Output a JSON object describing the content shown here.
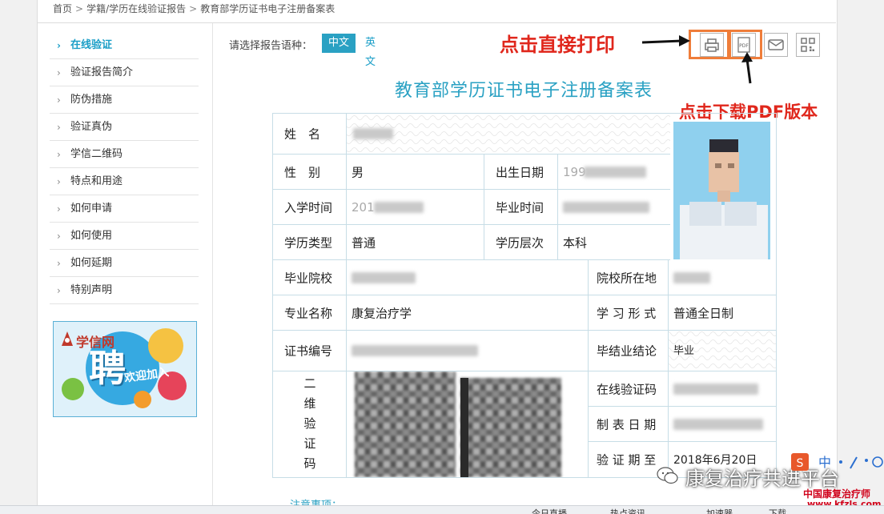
{
  "breadcrumb": [
    "首页",
    "学籍/学历在线验证报告",
    "教育部学历证书电子注册备案表"
  ],
  "sidebar": {
    "items": [
      {
        "label": "在线验证",
        "active": true
      },
      {
        "label": "验证报告简介"
      },
      {
        "label": "防伪措施"
      },
      {
        "label": "验证真伪"
      },
      {
        "label": "学信二维码"
      },
      {
        "label": "特点和用途"
      },
      {
        "label": "如何申请"
      },
      {
        "label": "如何使用"
      },
      {
        "label": "如何延期"
      },
      {
        "label": "特别声明"
      }
    ],
    "ad": {
      "brand": "学信网",
      "big": "聘",
      "small": "欢迎加入"
    }
  },
  "language": {
    "prompt": "请选择报告语种：",
    "options": [
      "中文",
      "英文"
    ],
    "selected": "中文"
  },
  "toolbar": {
    "icons": [
      "print-icon",
      "pdf-icon",
      "mail-icon",
      "qr-icon"
    ]
  },
  "annotations": {
    "print": "点击直接打印",
    "pdf": "点击下载PDF版本"
  },
  "report": {
    "title": "教育部学历证书电子注册备案表",
    "labels": {
      "name": "姓　名",
      "gender": "性　别",
      "birth": "出生日期",
      "enroll": "入学时间",
      "graduate": "毕业时间",
      "edu_type": "学历类型",
      "edu_level": "学历层次",
      "school": "毕业院校",
      "school_loc": "院校所在地",
      "major": "专业名称",
      "study_form": "学 习 形 式",
      "cert_no": "证书编号",
      "conclusion": "毕结业结论",
      "qr_chars": [
        "二",
        "维",
        "验",
        "证",
        "码"
      ],
      "online_code": "在线验证码",
      "made_date": "制 表 日 期",
      "valid_until": "验 证 期 至"
    },
    "values": {
      "gender": "男",
      "birth_partial": "199",
      "enroll_partial": "201",
      "edu_type": "普通",
      "edu_level": "本科",
      "major": "康复治疗学",
      "study_form": "普通全日制",
      "conclusion": "毕业",
      "valid_until": "2018年6月20日"
    }
  },
  "notes": {
    "label": "注意事项："
  },
  "watermark": {
    "text": "康复治疗共进平台",
    "red1": "中国康复治疗师",
    "red2": "www.kfzls.com"
  },
  "statusbar": {
    "items": [
      "今日直播",
      "热点资讯",
      "加速器",
      "下载"
    ]
  },
  "colors": {
    "accent": "#2aa1c3",
    "annotation": "#e0271c",
    "highlight": "#ef7d3a"
  }
}
